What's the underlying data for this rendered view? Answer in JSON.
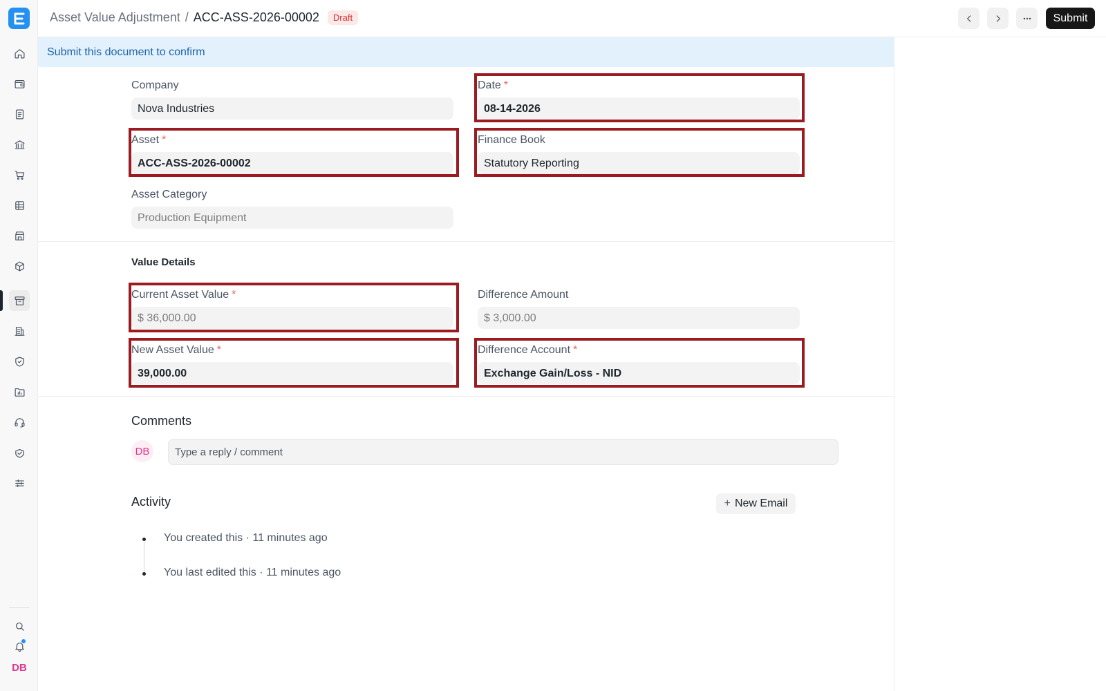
{
  "sidebar": {
    "items": [
      {
        "icon": "home-icon"
      },
      {
        "icon": "wallet-icon"
      },
      {
        "icon": "document-icon"
      },
      {
        "icon": "bank-icon"
      },
      {
        "icon": "cart-icon"
      },
      {
        "icon": "table-icon"
      },
      {
        "icon": "store-icon"
      },
      {
        "icon": "box-icon"
      },
      {
        "icon": "archive-icon"
      },
      {
        "icon": "building-icon"
      },
      {
        "icon": "shield-icon"
      },
      {
        "icon": "folder-chart-icon"
      },
      {
        "icon": "headset-icon"
      },
      {
        "icon": "handshake-icon"
      },
      {
        "icon": "sliders-icon"
      }
    ],
    "active_item": "archive-icon",
    "avatar": "DB"
  },
  "header": {
    "parent": "Asset Value Adjustment",
    "separator": "/",
    "title": "ACC-ASS-2026-00002",
    "status": "Draft",
    "submit_label": "Submit"
  },
  "banner": {
    "text": "Submit this document to confirm"
  },
  "form": {
    "company": {
      "label": "Company",
      "value": "Nova Industries"
    },
    "date": {
      "label": "Date",
      "required": "*",
      "value": "08-14-2026"
    },
    "asset": {
      "label": "Asset",
      "required": "*",
      "value": "ACC-ASS-2026-00002"
    },
    "finance_book": {
      "label": "Finance Book",
      "value": "Statutory Reporting"
    },
    "asset_category": {
      "label": "Asset Category",
      "value": "Production Equipment"
    },
    "value_details_title": "Value Details",
    "current_asset_value": {
      "label": "Current Asset Value",
      "required": "*",
      "value": "$ 36,000.00"
    },
    "difference_amount": {
      "label": "Difference Amount",
      "value": "$ 3,000.00"
    },
    "new_asset_value": {
      "label": "New Asset Value",
      "required": "*",
      "value": "39,000.00"
    },
    "difference_account": {
      "label": "Difference Account",
      "required": "*",
      "value": "Exchange Gain/Loss - NID"
    }
  },
  "comments": {
    "title": "Comments",
    "avatar": "DB",
    "placeholder": "Type a reply / comment"
  },
  "activity": {
    "title": "Activity",
    "new_email_label": "New Email",
    "items": [
      "You created this · 11 minutes ago",
      "You last edited this · 11 minutes ago"
    ]
  },
  "colors": {
    "accent": "#2490ef",
    "highlight": "#9b1b20",
    "banner_bg": "#e3f1fd",
    "draft_badge": "#d4332f"
  }
}
